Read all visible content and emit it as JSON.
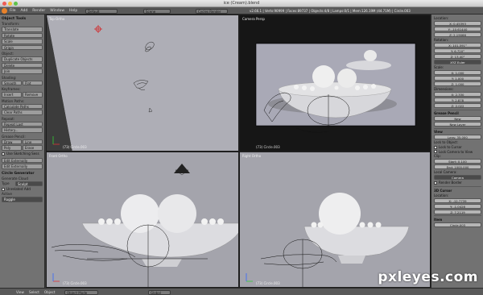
{
  "window": {
    "title": "ice (Cream).blend"
  },
  "info_bar": {
    "menus": [
      "File",
      "Add",
      "Render",
      "Window",
      "Help"
    ],
    "layout": "Default",
    "scene": "Scene",
    "engine": "Cycles Render",
    "stats": "v2.66.1 | Verts:90999 | Faces:89737 | Objects:4/8 | Lamps:0/1 | Mem:126.19M (44.71M) | Circle.003"
  },
  "toolshelf": {
    "header": "Object Tools",
    "transform": {
      "label": "Transform:",
      "buttons": [
        "Translate",
        "Rotate",
        "Scale",
        "Origin"
      ]
    },
    "object": {
      "label": "Object:",
      "buttons": [
        "Duplicate Objects",
        "Delete",
        "Join"
      ]
    },
    "shading": {
      "label": "Shading:",
      "buttons": [
        "Smooth",
        "Flat"
      ]
    },
    "keyframes": {
      "label": "Keyframes:",
      "buttons": [
        "Insert",
        "Remove"
      ]
    },
    "motion_paths": {
      "label": "Motion Paths:",
      "buttons": [
        "Calculate Paths",
        "Clear Paths"
      ]
    },
    "repeat": {
      "label": "Repeat:",
      "buttons": [
        "Repeat Last",
        "History..."
      ]
    },
    "grease_pencil": {
      "label": "Grease Pencil:",
      "buttons": [
        "Draw",
        "Line",
        "Poly",
        "Erase"
      ],
      "check": "Use Sketching Sess"
    },
    "edit_relations": {
      "buttons": [
        "Edit Externally",
        "Edit Externally"
      ]
    },
    "operator": {
      "header": "Circle Generator",
      "rows": [
        "Generate Cloud",
        "Type",
        "Multiply"
      ],
      "check": "Unrelated Add",
      "type_value": "Sculpt",
      "bottom_label": "Active",
      "bottom_value": "Ruggle"
    }
  },
  "viewports": {
    "top_left": {
      "label": "Top Ortho",
      "object": "(73) Circle.003"
    },
    "top_right": {
      "label": "Camera Persp",
      "object": "(73) Circle.003"
    },
    "bottom_left": {
      "label": "Front Ortho",
      "object": "(73) Circle.003"
    },
    "bottom_right": {
      "label": "Right Ortho",
      "object": "(73) Circle.003"
    }
  },
  "properties": {
    "location_label": "Location:",
    "location": [
      "X: 0.45393",
      "Y: -10.61440",
      "Z: 2.19066"
    ],
    "rotation_label": "Rotation:",
    "rotation": [
      "X: 101.591°",
      "Y: 6.720°",
      "Z: 13.40°"
    ],
    "rotation_mode": "XYZ Euler",
    "scale_label": "Scale:",
    "scale": [
      "X: 1.000",
      "Y: 1.000",
      "Z: 1.000"
    ],
    "dimensions_label": "Dimensions:",
    "dimensions": [
      "X: 2.330",
      "Y: 2.878",
      "Z: 2.022"
    ],
    "grease_pencil": "Grease Pencil",
    "new_label": "New",
    "new_layer_label": "New Layer",
    "view_label": "View",
    "lens": "Lens: 35.000",
    "lock_to_object": "Lock to Object:",
    "lock_to_cursor": "Lock to Cursor",
    "lock_camera": "Lock Camera to View",
    "clip_label": "Clip:",
    "clip_start": "Start: 0.100",
    "clip_end": "End: 1000.000",
    "local_camera": "Local Camera:",
    "camera_value": "Camera",
    "render_border": "Render Border",
    "cursor_label": "3D Cursor",
    "cursor_location_label": "Location:",
    "cursor": [
      "X: -12.7739",
      "Y: -1.0428",
      "Z: 7.2119"
    ],
    "item_label": "Item",
    "item_value": "Circle.003"
  },
  "bottom_bar": {
    "menus": [
      "View",
      "Select",
      "Object"
    ],
    "mode": "Object Mode",
    "pivot": "Global"
  },
  "watermark": "pxleyes.com"
}
